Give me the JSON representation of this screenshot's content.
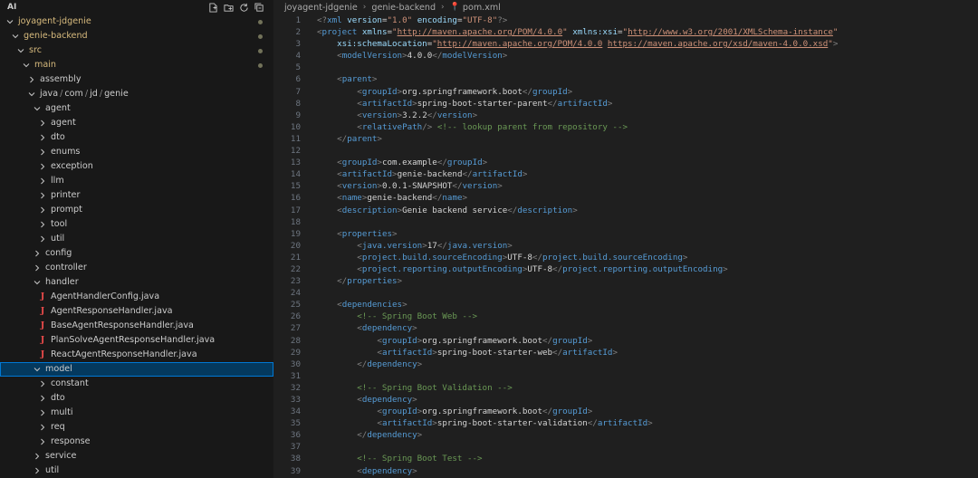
{
  "sidebar": {
    "title": "AI",
    "actions": [
      "new-file-icon",
      "new-folder-icon",
      "refresh-icon",
      "collapse-all-icon"
    ],
    "tree": [
      {
        "label": "joyagent-jdgenie",
        "indent": 0,
        "type": "folder-open",
        "yellow": true,
        "dot": true
      },
      {
        "label": "genie-backend",
        "indent": 1,
        "type": "folder-open",
        "yellow": true,
        "dot": true
      },
      {
        "label": "src",
        "indent": 2,
        "type": "folder-open",
        "yellow": true,
        "dot": true
      },
      {
        "label": "main",
        "indent": 3,
        "type": "folder-open",
        "yellow": true,
        "dot": true
      },
      {
        "label": "assembly",
        "indent": 4,
        "type": "folder-closed"
      },
      {
        "label": "java/com/jd/genie",
        "indent": 4,
        "type": "folder-open"
      },
      {
        "label": "agent",
        "indent": 5,
        "type": "folder-open"
      },
      {
        "label": "agent",
        "indent": 6,
        "type": "folder-closed"
      },
      {
        "label": "dto",
        "indent": 6,
        "type": "folder-closed"
      },
      {
        "label": "enums",
        "indent": 6,
        "type": "folder-closed"
      },
      {
        "label": "exception",
        "indent": 6,
        "type": "folder-closed"
      },
      {
        "label": "llm",
        "indent": 6,
        "type": "folder-closed"
      },
      {
        "label": "printer",
        "indent": 6,
        "type": "folder-closed"
      },
      {
        "label": "prompt",
        "indent": 6,
        "type": "folder-closed"
      },
      {
        "label": "tool",
        "indent": 6,
        "type": "folder-closed"
      },
      {
        "label": "util",
        "indent": 6,
        "type": "folder-closed"
      },
      {
        "label": "config",
        "indent": 5,
        "type": "folder-closed"
      },
      {
        "label": "controller",
        "indent": 5,
        "type": "folder-closed"
      },
      {
        "label": "handler",
        "indent": 5,
        "type": "folder-open"
      },
      {
        "label": "AgentHandlerConfig.java",
        "indent": 6,
        "type": "java"
      },
      {
        "label": "AgentResponseHandler.java",
        "indent": 6,
        "type": "java"
      },
      {
        "label": "BaseAgentResponseHandler.java",
        "indent": 6,
        "type": "java"
      },
      {
        "label": "PlanSolveAgentResponseHandler.java",
        "indent": 6,
        "type": "java"
      },
      {
        "label": "ReactAgentResponseHandler.java",
        "indent": 6,
        "type": "java"
      },
      {
        "label": "model",
        "indent": 5,
        "type": "folder-open",
        "selected": true
      },
      {
        "label": "constant",
        "indent": 6,
        "type": "folder-closed"
      },
      {
        "label": "dto",
        "indent": 6,
        "type": "folder-closed"
      },
      {
        "label": "multi",
        "indent": 6,
        "type": "folder-closed"
      },
      {
        "label": "req",
        "indent": 6,
        "type": "folder-closed"
      },
      {
        "label": "response",
        "indent": 6,
        "type": "folder-closed"
      },
      {
        "label": "service",
        "indent": 5,
        "type": "folder-closed"
      },
      {
        "label": "util",
        "indent": 5,
        "type": "folder-closed"
      }
    ]
  },
  "breadcrumb": [
    "joyagent-jdgenie",
    "genie-backend",
    "pom.xml"
  ],
  "code": [
    {
      "n": "1",
      "tokens": [
        [
          "pu",
          "<?"
        ],
        [
          "t",
          "xml"
        ],
        [
          "a",
          " version"
        ],
        [
          "v",
          "="
        ],
        [
          "s",
          "\"1.0\""
        ],
        [
          "a",
          " encoding"
        ],
        [
          "v",
          "="
        ],
        [
          "s",
          "\"UTF-8\""
        ],
        [
          "pu",
          "?>"
        ]
      ]
    },
    {
      "n": "2",
      "tokens": [
        [
          "pu",
          "<"
        ],
        [
          "t",
          "project"
        ],
        [
          "a",
          " xmlns"
        ],
        [
          "v",
          "="
        ],
        [
          "s",
          "\""
        ],
        [
          "u",
          "http://maven.apache.org/POM/4.0.0"
        ],
        [
          "s",
          "\""
        ],
        [
          "a",
          " xmlns:xsi"
        ],
        [
          "v",
          "="
        ],
        [
          "s",
          "\""
        ],
        [
          "u",
          "http://www.w3.org/2001/XMLSchema-instance"
        ],
        [
          "s",
          "\""
        ]
      ]
    },
    {
      "n": "3",
      "tokens": [
        [
          "a",
          "    xsi:schemaLocation"
        ],
        [
          "v",
          "="
        ],
        [
          "s",
          "\""
        ],
        [
          "u",
          "http://maven.apache.org/POM/4.0.0"
        ],
        [
          "s",
          " "
        ],
        [
          "u",
          "https://maven.apache.org/xsd/maven-4.0.0.xsd"
        ],
        [
          "s",
          "\""
        ],
        [
          "pu",
          ">"
        ]
      ]
    },
    {
      "n": "4",
      "tokens": [
        [
          "v",
          "    "
        ],
        [
          "pu",
          "<"
        ],
        [
          "t",
          "modelVersion"
        ],
        [
          "pu",
          ">"
        ],
        [
          "v",
          "4.0.0"
        ],
        [
          "pu",
          "</"
        ],
        [
          "t",
          "modelVersion"
        ],
        [
          "pu",
          ">"
        ]
      ]
    },
    {
      "n": "5",
      "tokens": []
    },
    {
      "n": "6",
      "tokens": [
        [
          "v",
          "    "
        ],
        [
          "pu",
          "<"
        ],
        [
          "t",
          "parent"
        ],
        [
          "pu",
          ">"
        ]
      ]
    },
    {
      "n": "7",
      "tokens": [
        [
          "v",
          "        "
        ],
        [
          "pu",
          "<"
        ],
        [
          "t",
          "groupId"
        ],
        [
          "pu",
          ">"
        ],
        [
          "v",
          "org.springframework.boot"
        ],
        [
          "pu",
          "</"
        ],
        [
          "t",
          "groupId"
        ],
        [
          "pu",
          ">"
        ]
      ]
    },
    {
      "n": "8",
      "tokens": [
        [
          "v",
          "        "
        ],
        [
          "pu",
          "<"
        ],
        [
          "t",
          "artifactId"
        ],
        [
          "pu",
          ">"
        ],
        [
          "v",
          "spring-boot-starter-parent"
        ],
        [
          "pu",
          "</"
        ],
        [
          "t",
          "artifactId"
        ],
        [
          "pu",
          ">"
        ]
      ]
    },
    {
      "n": "9",
      "tokens": [
        [
          "v",
          "        "
        ],
        [
          "pu",
          "<"
        ],
        [
          "t",
          "version"
        ],
        [
          "pu",
          ">"
        ],
        [
          "v",
          "3.2.2"
        ],
        [
          "pu",
          "</"
        ],
        [
          "t",
          "version"
        ],
        [
          "pu",
          ">"
        ]
      ]
    },
    {
      "n": "10",
      "tokens": [
        [
          "v",
          "        "
        ],
        [
          "pu",
          "<"
        ],
        [
          "t",
          "relativePath"
        ],
        [
          "pu",
          "/>"
        ],
        [
          "c",
          " <!-- lookup parent from repository -->"
        ]
      ]
    },
    {
      "n": "11",
      "tokens": [
        [
          "v",
          "    "
        ],
        [
          "pu",
          "</"
        ],
        [
          "t",
          "parent"
        ],
        [
          "pu",
          ">"
        ]
      ]
    },
    {
      "n": "12",
      "tokens": []
    },
    {
      "n": "13",
      "tokens": [
        [
          "v",
          "    "
        ],
        [
          "pu",
          "<"
        ],
        [
          "t",
          "groupId"
        ],
        [
          "pu",
          ">"
        ],
        [
          "v",
          "com.example"
        ],
        [
          "pu",
          "</"
        ],
        [
          "t",
          "groupId"
        ],
        [
          "pu",
          ">"
        ]
      ]
    },
    {
      "n": "14",
      "tokens": [
        [
          "v",
          "    "
        ],
        [
          "pu",
          "<"
        ],
        [
          "t",
          "artifactId"
        ],
        [
          "pu",
          ">"
        ],
        [
          "v",
          "genie-backend"
        ],
        [
          "pu",
          "</"
        ],
        [
          "t",
          "artifactId"
        ],
        [
          "pu",
          ">"
        ]
      ]
    },
    {
      "n": "15",
      "tokens": [
        [
          "v",
          "    "
        ],
        [
          "pu",
          "<"
        ],
        [
          "t",
          "version"
        ],
        [
          "pu",
          ">"
        ],
        [
          "v",
          "0.0.1-SNAPSHOT"
        ],
        [
          "pu",
          "</"
        ],
        [
          "t",
          "version"
        ],
        [
          "pu",
          ">"
        ]
      ]
    },
    {
      "n": "16",
      "tokens": [
        [
          "v",
          "    "
        ],
        [
          "pu",
          "<"
        ],
        [
          "t",
          "name"
        ],
        [
          "pu",
          ">"
        ],
        [
          "v",
          "genie-backend"
        ],
        [
          "pu",
          "</"
        ],
        [
          "t",
          "name"
        ],
        [
          "pu",
          ">"
        ]
      ]
    },
    {
      "n": "17",
      "tokens": [
        [
          "v",
          "    "
        ],
        [
          "pu",
          "<"
        ],
        [
          "t",
          "description"
        ],
        [
          "pu",
          ">"
        ],
        [
          "v",
          "Genie backend service"
        ],
        [
          "pu",
          "</"
        ],
        [
          "t",
          "description"
        ],
        [
          "pu",
          ">"
        ]
      ]
    },
    {
      "n": "18",
      "tokens": []
    },
    {
      "n": "19",
      "tokens": [
        [
          "v",
          "    "
        ],
        [
          "pu",
          "<"
        ],
        [
          "t",
          "properties"
        ],
        [
          "pu",
          ">"
        ]
      ]
    },
    {
      "n": "20",
      "tokens": [
        [
          "v",
          "        "
        ],
        [
          "pu",
          "<"
        ],
        [
          "t",
          "java.version"
        ],
        [
          "pu",
          ">"
        ],
        [
          "v",
          "17"
        ],
        [
          "pu",
          "</"
        ],
        [
          "t",
          "java.version"
        ],
        [
          "pu",
          ">"
        ]
      ]
    },
    {
      "n": "21",
      "tokens": [
        [
          "v",
          "        "
        ],
        [
          "pu",
          "<"
        ],
        [
          "t",
          "project.build.sourceEncoding"
        ],
        [
          "pu",
          ">"
        ],
        [
          "v",
          "UTF-8"
        ],
        [
          "pu",
          "</"
        ],
        [
          "t",
          "project.build.sourceEncoding"
        ],
        [
          "pu",
          ">"
        ]
      ]
    },
    {
      "n": "22",
      "tokens": [
        [
          "v",
          "        "
        ],
        [
          "pu",
          "<"
        ],
        [
          "t",
          "project.reporting.outputEncoding"
        ],
        [
          "pu",
          ">"
        ],
        [
          "v",
          "UTF-8"
        ],
        [
          "pu",
          "</"
        ],
        [
          "t",
          "project.reporting.outputEncoding"
        ],
        [
          "pu",
          ">"
        ]
      ]
    },
    {
      "n": "23",
      "tokens": [
        [
          "v",
          "    "
        ],
        [
          "pu",
          "</"
        ],
        [
          "t",
          "properties"
        ],
        [
          "pu",
          ">"
        ]
      ]
    },
    {
      "n": "24",
      "tokens": []
    },
    {
      "n": "25",
      "tokens": [
        [
          "v",
          "    "
        ],
        [
          "pu",
          "<"
        ],
        [
          "t",
          "dependencies"
        ],
        [
          "pu",
          ">"
        ]
      ]
    },
    {
      "n": "26",
      "tokens": [
        [
          "v",
          "        "
        ],
        [
          "c",
          "<!-- Spring Boot Web -->"
        ]
      ]
    },
    {
      "n": "27",
      "tokens": [
        [
          "v",
          "        "
        ],
        [
          "pu",
          "<"
        ],
        [
          "t",
          "dependency"
        ],
        [
          "pu",
          ">"
        ]
      ]
    },
    {
      "n": "28",
      "tokens": [
        [
          "v",
          "            "
        ],
        [
          "pu",
          "<"
        ],
        [
          "t",
          "groupId"
        ],
        [
          "pu",
          ">"
        ],
        [
          "v",
          "org.springframework.boot"
        ],
        [
          "pu",
          "</"
        ],
        [
          "t",
          "groupId"
        ],
        [
          "pu",
          ">"
        ]
      ]
    },
    {
      "n": "29",
      "tokens": [
        [
          "v",
          "            "
        ],
        [
          "pu",
          "<"
        ],
        [
          "t",
          "artifactId"
        ],
        [
          "pu",
          ">"
        ],
        [
          "v",
          "spring-boot-starter-web"
        ],
        [
          "pu",
          "</"
        ],
        [
          "t",
          "artifactId"
        ],
        [
          "pu",
          ">"
        ]
      ]
    },
    {
      "n": "30",
      "tokens": [
        [
          "v",
          "        "
        ],
        [
          "pu",
          "</"
        ],
        [
          "t",
          "dependency"
        ],
        [
          "pu",
          ">"
        ]
      ]
    },
    {
      "n": "31",
      "tokens": []
    },
    {
      "n": "32",
      "tokens": [
        [
          "v",
          "        "
        ],
        [
          "c",
          "<!-- Spring Boot Validation -->"
        ]
      ]
    },
    {
      "n": "33",
      "tokens": [
        [
          "v",
          "        "
        ],
        [
          "pu",
          "<"
        ],
        [
          "t",
          "dependency"
        ],
        [
          "pu",
          ">"
        ]
      ]
    },
    {
      "n": "34",
      "tokens": [
        [
          "v",
          "            "
        ],
        [
          "pu",
          "<"
        ],
        [
          "t",
          "groupId"
        ],
        [
          "pu",
          ">"
        ],
        [
          "v",
          "org.springframework.boot"
        ],
        [
          "pu",
          "</"
        ],
        [
          "t",
          "groupId"
        ],
        [
          "pu",
          ">"
        ]
      ]
    },
    {
      "n": "35",
      "tokens": [
        [
          "v",
          "            "
        ],
        [
          "pu",
          "<"
        ],
        [
          "t",
          "artifactId"
        ],
        [
          "pu",
          ">"
        ],
        [
          "v",
          "spring-boot-starter-validation"
        ],
        [
          "pu",
          "</"
        ],
        [
          "t",
          "artifactId"
        ],
        [
          "pu",
          ">"
        ]
      ]
    },
    {
      "n": "36",
      "tokens": [
        [
          "v",
          "        "
        ],
        [
          "pu",
          "</"
        ],
        [
          "t",
          "dependency"
        ],
        [
          "pu",
          ">"
        ]
      ]
    },
    {
      "n": "37",
      "tokens": []
    },
    {
      "n": "38",
      "tokens": [
        [
          "v",
          "        "
        ],
        [
          "c",
          "<!-- Spring Boot Test -->"
        ]
      ]
    },
    {
      "n": "39",
      "tokens": [
        [
          "v",
          "        "
        ],
        [
          "pu",
          "<"
        ],
        [
          "t",
          "dependency"
        ],
        [
          "pu",
          ">"
        ]
      ]
    }
  ]
}
